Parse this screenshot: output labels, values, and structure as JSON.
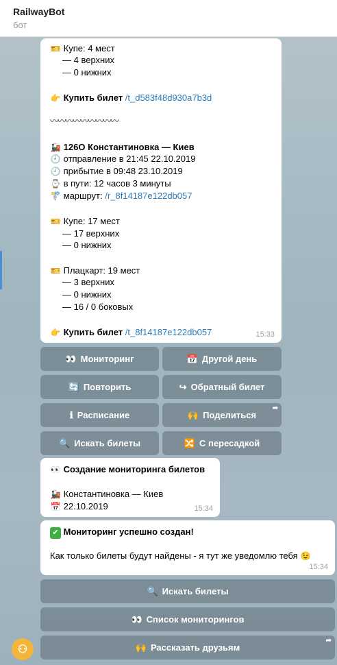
{
  "header": {
    "title": "RailwayBot",
    "subtitle": "бот"
  },
  "msg1": {
    "lines": [
      "Купе: 4 мест",
      "— 4 верхних",
      "— 0 нижних",
      "Купить билет",
      "/t_d583f48d930a7b3d",
      "〰〰〰〰〰〰〰〰〰",
      "126О Константиновка — Киев",
      "отправление в 21:45 22.10.2019",
      "прибытие в 09:48 23.10.2019",
      "в пути: 12 часов 3 минуты",
      "маршрут:",
      "/r_8f14187e122db057",
      "Купе: 17 мест",
      "— 17 верхних",
      "— 0 нижних",
      "Плацкарт: 19 мест",
      "— 3 верхних",
      "— 0 нижних",
      "— 16 / 0 боковых",
      "Купить билет",
      "/t_8f14187e122db057"
    ],
    "time": "15:33"
  },
  "keyboard1": {
    "monitoring": "Мониторинг",
    "other_day": "Другой день",
    "repeat": "Повторить",
    "return_ticket": "Обратный билет",
    "schedule": "Расписание",
    "share": "Поделиться",
    "search": "Искать билеты",
    "transfer": "С пересадкой"
  },
  "msg2": {
    "title": "Создание мониторинга билетов",
    "route": "Константиновка — Киев",
    "date": "22.10.2019",
    "time": "15:34"
  },
  "msg3": {
    "title": "Мониторинг успешно создан!",
    "text": "Как только билеты будут найдены - я тут же уведомлю тебя",
    "time": "15:34"
  },
  "keyboard2": {
    "search": "Искать билеты",
    "list": "Список мониторингов",
    "tell": "Рассказать друзьям"
  },
  "colors": {
    "link": "#2a7ab8",
    "button_bg": "#5f6e76",
    "check_green": "#3cb043"
  },
  "icons": [
    "ticket-icon",
    "point-right-icon",
    "train-icon",
    "clock-icon",
    "watch-icon",
    "route-pin-icon",
    "eyes-icon",
    "calendar-icon",
    "repeat-icon",
    "return-icon",
    "info-icon",
    "raised-hands-icon",
    "magnifier-icon",
    "shuffle-icon",
    "check-icon",
    "wink-icon",
    "share-arrow-icon"
  ]
}
